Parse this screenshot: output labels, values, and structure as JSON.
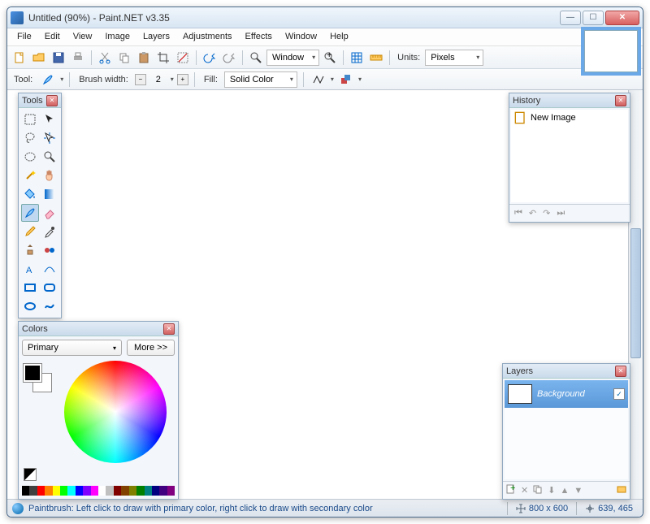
{
  "window": {
    "title": "Untitled (90%) - Paint.NET v3.35"
  },
  "menu": [
    "File",
    "Edit",
    "View",
    "Image",
    "Layers",
    "Adjustments",
    "Effects",
    "Window",
    "Help"
  ],
  "toolbar1": {
    "zoom_mode": "Window",
    "units_label": "Units:",
    "units_value": "Pixels"
  },
  "toolbar2": {
    "tool_label": "Tool:",
    "brush_label": "Brush width:",
    "brush_value": "2",
    "fill_label": "Fill:",
    "fill_value": "Solid Color"
  },
  "panels": {
    "tools_title": "Tools",
    "history_title": "History",
    "layers_title": "Layers",
    "colors_title": "Colors"
  },
  "history": {
    "items": [
      "New Image"
    ]
  },
  "layers": {
    "items": [
      {
        "name": "Background",
        "visible": true
      }
    ]
  },
  "colors": {
    "selector": "Primary",
    "more": "More >>",
    "palette": [
      "#000000",
      "#404040",
      "#ff0000",
      "#ff8000",
      "#ffff00",
      "#00ff00",
      "#00ffff",
      "#0000ff",
      "#8000ff",
      "#ff00ff",
      "#ffffff",
      "#c0c0c0",
      "#800000",
      "#804000",
      "#808000",
      "#008000",
      "#008080",
      "#000080",
      "#400080",
      "#800080"
    ]
  },
  "status": {
    "help": "Paintbrush: Left click to draw with primary color, right click to draw with secondary color",
    "dims": "800 x 600",
    "cursor": "639, 465"
  }
}
